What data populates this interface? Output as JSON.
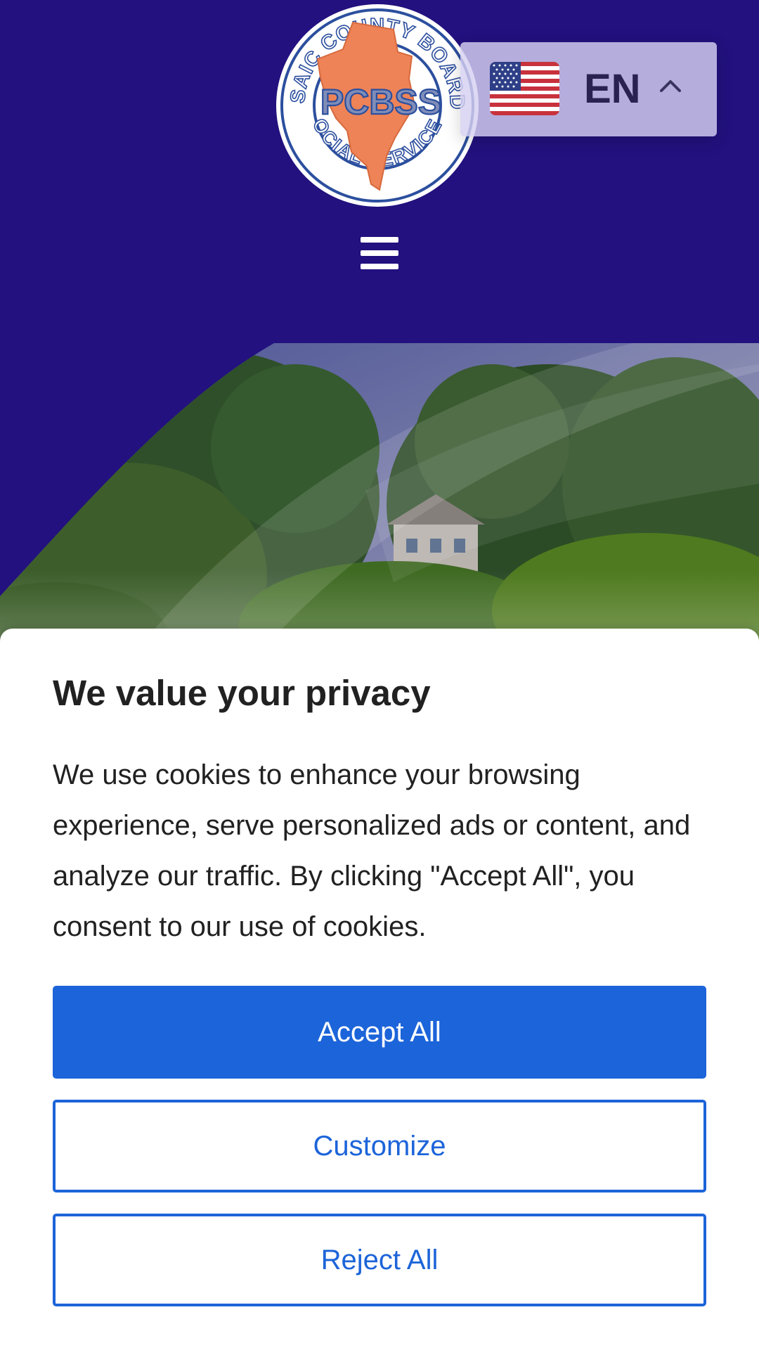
{
  "header": {
    "logo": {
      "ring_text_top": "PASSAIC COUNTY BOARD OF",
      "ring_text_bottom": "SOCIAL SERVICES",
      "monogram": "PCBSS"
    },
    "language": {
      "code": "EN",
      "flag_icon": "us-flag-icon",
      "caret_icon": "chevron-up-icon"
    },
    "menu_icon": "hamburger-menu-icon"
  },
  "colors": {
    "header_background": "#22117e",
    "language_box": "#d6d0f0",
    "primary_button": "#1c64d9",
    "logo_state_fill": "#ee8357"
  },
  "cookie_banner": {
    "title": "We value your privacy",
    "body": "We use cookies to enhance your browsing experience, serve personalized ads or content, and analyze our traffic. By clicking \"Accept All\", you consent to our use of cookies.",
    "buttons": {
      "accept_all": "Accept All",
      "customize": "Customize",
      "reject_all": "Reject All"
    }
  }
}
